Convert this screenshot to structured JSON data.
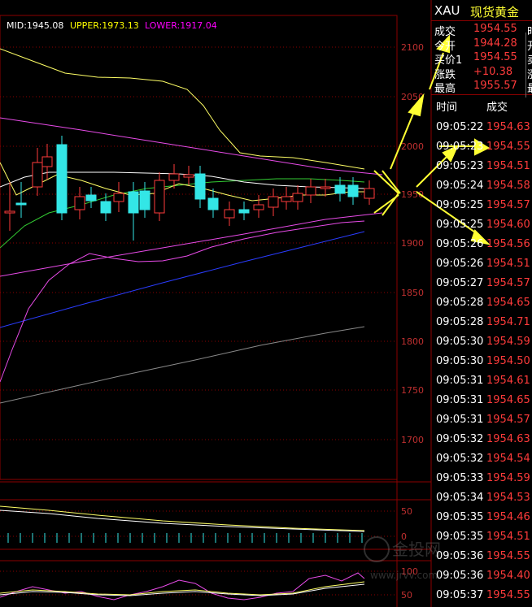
{
  "chart_header": {
    "mid": "MID:1945.08",
    "upper": "UPPER:1973.13",
    "lower": "LOWER:1917.04",
    "mid_color": "#ffffff",
    "upper_color": "#ffff00",
    "lower_color": "#ff00ff"
  },
  "price_axis": [
    "2100",
    "2050",
    "2000",
    "1950",
    "1900",
    "1850",
    "1800",
    "1750",
    "1700"
  ],
  "indicator_axis_1": [
    "50",
    "0"
  ],
  "indicator_axis_2": [
    "100",
    "50"
  ],
  "quote": {
    "symbol": "XAU",
    "name": "现货黄金",
    "rows": [
      {
        "label": "成交",
        "value": "1954.55",
        "cut": "时"
      },
      {
        "label": "今开",
        "value": "1944.28",
        "cut": "开"
      },
      {
        "label": "买价1",
        "value": "1954.55",
        "cut": "卖"
      },
      {
        "label": "涨跌",
        "value": "+10.38",
        "cut": "涨"
      },
      {
        "label": "最高",
        "value": "1955.57",
        "cut": "最"
      }
    ]
  },
  "ticks": {
    "headers": {
      "time": "时间",
      "price": "成交"
    },
    "rows": [
      {
        "time": "09:05:22",
        "price": "1954.63"
      },
      {
        "time": "09:05:23",
        "price": "1954.55"
      },
      {
        "time": "09:05:23",
        "price": "1954.51"
      },
      {
        "time": "09:05:24",
        "price": "1954.58"
      },
      {
        "time": "09:05:25",
        "price": "1954.57"
      },
      {
        "time": "09:05:25",
        "price": "1954.60"
      },
      {
        "time": "09:05:26",
        "price": "1954.56"
      },
      {
        "time": "09:05:26",
        "price": "1954.51"
      },
      {
        "time": "09:05:27",
        "price": "1954.57"
      },
      {
        "time": "09:05:28",
        "price": "1954.65"
      },
      {
        "time": "09:05:28",
        "price": "1954.71"
      },
      {
        "time": "09:05:30",
        "price": "1954.59"
      },
      {
        "time": "09:05:30",
        "price": "1954.50"
      },
      {
        "time": "09:05:31",
        "price": "1954.61"
      },
      {
        "time": "09:05:31",
        "price": "1954.65"
      },
      {
        "time": "09:05:31",
        "price": "1954.57"
      },
      {
        "time": "09:05:32",
        "price": "1954.63"
      },
      {
        "time": "09:05:32",
        "price": "1954.54"
      },
      {
        "time": "09:05:33",
        "price": "1954.59"
      },
      {
        "time": "09:05:34",
        "price": "1954.53"
      },
      {
        "time": "09:05:35",
        "price": "1954.46"
      },
      {
        "time": "09:05:35",
        "price": "1954.51"
      },
      {
        "time": "09:05:36",
        "price": "1954.55"
      },
      {
        "time": "09:05:36",
        "price": "1954.40"
      },
      {
        "time": "09:05:37",
        "price": "1954.55"
      }
    ]
  },
  "watermark": {
    "brand": "金投网",
    "url": "www.jrvv.com"
  },
  "colors": {
    "grid": "#8b0000",
    "bull": "#ff3b3b",
    "bear": "#33e6e6",
    "ma_yellow": "#ffff66",
    "ma_green": "#33cc33",
    "ma_blue": "#2a3cff",
    "ma_magenta": "#e84be8",
    "ma_grey": "#8a8a8a",
    "arrow": "#ffff33"
  }
}
